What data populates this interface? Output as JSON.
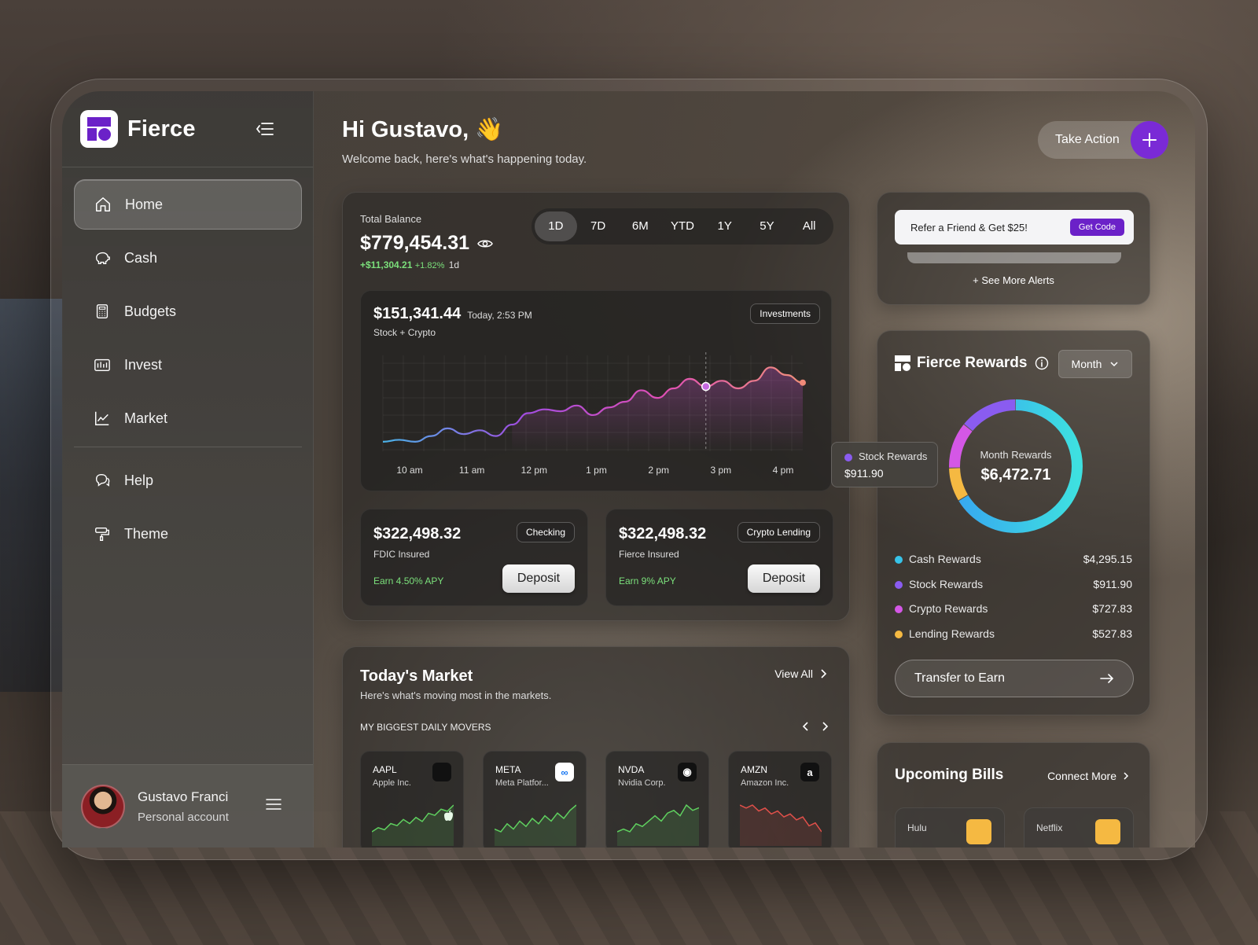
{
  "app": {
    "name": "Fierce",
    "accent": "#7a2ad6"
  },
  "sidebar": {
    "items": [
      {
        "label": "Home",
        "icon": "home-icon",
        "active": true
      },
      {
        "label": "Cash",
        "icon": "piggy-bank-icon"
      },
      {
        "label": "Budgets",
        "icon": "calculator-icon"
      },
      {
        "label": "Invest",
        "icon": "chart-box-icon"
      },
      {
        "label": "Market",
        "icon": "line-chart-icon"
      }
    ],
    "secondary": [
      {
        "label": "Help",
        "icon": "chat-help-icon"
      },
      {
        "label": "Theme",
        "icon": "paint-roller-icon"
      }
    ],
    "profile": {
      "name": "Gustavo Franci",
      "subtitle": "Personal account"
    }
  },
  "header": {
    "greeting": "Hi Gustavo,",
    "emoji": "👋",
    "subtitle": "Welcome back, here's what's happening today.",
    "action_label": "Take Action"
  },
  "balance": {
    "label": "Total Balance",
    "amount": "$779,454.31",
    "change": "+$11,304.21",
    "change_pct": "+1.82%",
    "period": "1d",
    "ranges": [
      "1D",
      "7D",
      "6M",
      "YTD",
      "1Y",
      "5Y",
      "All"
    ],
    "active_range": "1D"
  },
  "investments": {
    "amount": "$151,341.44",
    "time": "Today, 2:53 PM",
    "subtitle": "Stock + Crypto",
    "badge": "Investments",
    "x_labels": [
      "10 am",
      "11 am",
      "12 pm",
      "1 pm",
      "2 pm",
      "3 pm",
      "4 pm"
    ]
  },
  "chart_data": {
    "type": "line",
    "x": [
      0,
      0.5,
      1,
      1.5,
      2,
      2.5,
      3,
      3.5,
      4,
      4.5,
      5,
      5.5,
      6,
      6.5,
      7,
      7.5,
      8,
      8.5,
      9,
      9.5,
      10,
      10.5,
      11,
      11.5,
      12,
      12.5,
      13
    ],
    "values": [
      5,
      6,
      5,
      8,
      12,
      9,
      11,
      8,
      14,
      20,
      22,
      21,
      24,
      19,
      23,
      26,
      32,
      28,
      33,
      38,
      34,
      37,
      33,
      37,
      44,
      40,
      36
    ],
    "xlabels": [
      "10 am",
      "11 am",
      "12 pm",
      "1 pm",
      "2 pm",
      "3 pm",
      "4 pm"
    ],
    "highlight_index": 20,
    "grid": true,
    "colors": [
      "#4ab3e8",
      "#a14de0",
      "#e04fb5",
      "#f0907a"
    ]
  },
  "accounts": [
    {
      "amount": "$322,498.32",
      "badge": "Checking",
      "subtitle": "FDIC Insured",
      "apy": "Earn 4.50% APY",
      "button": "Deposit"
    },
    {
      "amount": "$322,498.32",
      "badge": "Crypto Lending",
      "subtitle": "Fierce Insured",
      "apy": "Earn 9% APY",
      "button": "Deposit"
    }
  ],
  "market": {
    "title": "Today's Market",
    "subtitle": "Here's what's moving most in the markets.",
    "view_all": "View All",
    "section": "MY BIGGEST DAILY MOVERS",
    "movers": [
      {
        "symbol": "AAPL",
        "name": "Apple Inc.",
        "logo": "apple-icon",
        "logo_bg": "#111111",
        "logo_text": "",
        "trend": "up",
        "points": [
          2,
          4,
          3,
          6,
          5,
          8,
          6,
          9,
          7,
          11,
          10,
          13,
          12,
          15
        ]
      },
      {
        "symbol": "META",
        "name": "Meta Platfor...",
        "logo": "meta-icon",
        "logo_bg": "#ffffff",
        "logo_text": "∞",
        "trend": "up",
        "points": [
          3,
          2,
          5,
          3,
          6,
          4,
          7,
          5,
          8,
          6,
          9,
          7,
          10,
          12
        ]
      },
      {
        "symbol": "NVDA",
        "name": "Nvidia Corp.",
        "logo": "nvidia-icon",
        "logo_bg": "#111111",
        "logo_text": "◉",
        "trend": "up",
        "points": [
          2,
          3,
          2,
          5,
          4,
          6,
          8,
          6,
          9,
          10,
          8,
          12,
          10,
          11
        ]
      },
      {
        "symbol": "AMZN",
        "name": "Amazon Inc.",
        "logo": "amazon-icon",
        "logo_bg": "#111111",
        "logo_text": "a",
        "trend": "down",
        "points": [
          12,
          11,
          12,
          10,
          11,
          9,
          10,
          8,
          9,
          7,
          8,
          5,
          6,
          3
        ]
      }
    ]
  },
  "alerts": {
    "refer_text": "Refer a Friend & Get $25!",
    "refer_button": "Get Code",
    "see_more": "+ See More Alerts"
  },
  "rewards": {
    "title": "Fierce Rewards",
    "period": "Month",
    "center_label": "Month Rewards",
    "center_value": "$6,472.71",
    "tooltip_label": "Stock Rewards",
    "tooltip_value": "$911.90",
    "items": [
      {
        "label": "Cash Rewards",
        "value": "$4,295.15",
        "color": "#37c3e8",
        "amount": 4295.15
      },
      {
        "label": "Stock Rewards",
        "value": "$911.90",
        "color": "#8a5cf0",
        "amount": 911.9
      },
      {
        "label": "Crypto Rewards",
        "value": "$727.83",
        "color": "#d457e6",
        "amount": 727.83
      },
      {
        "label": "Lending Rewards",
        "value": "$527.83",
        "color": "#f5b942",
        "amount": 527.83
      }
    ],
    "transfer_label": "Transfer to Earn"
  },
  "bills": {
    "title": "Upcoming Bills",
    "connect": "Connect More",
    "items": [
      {
        "name": "Hulu"
      },
      {
        "name": "Netflix"
      }
    ]
  }
}
